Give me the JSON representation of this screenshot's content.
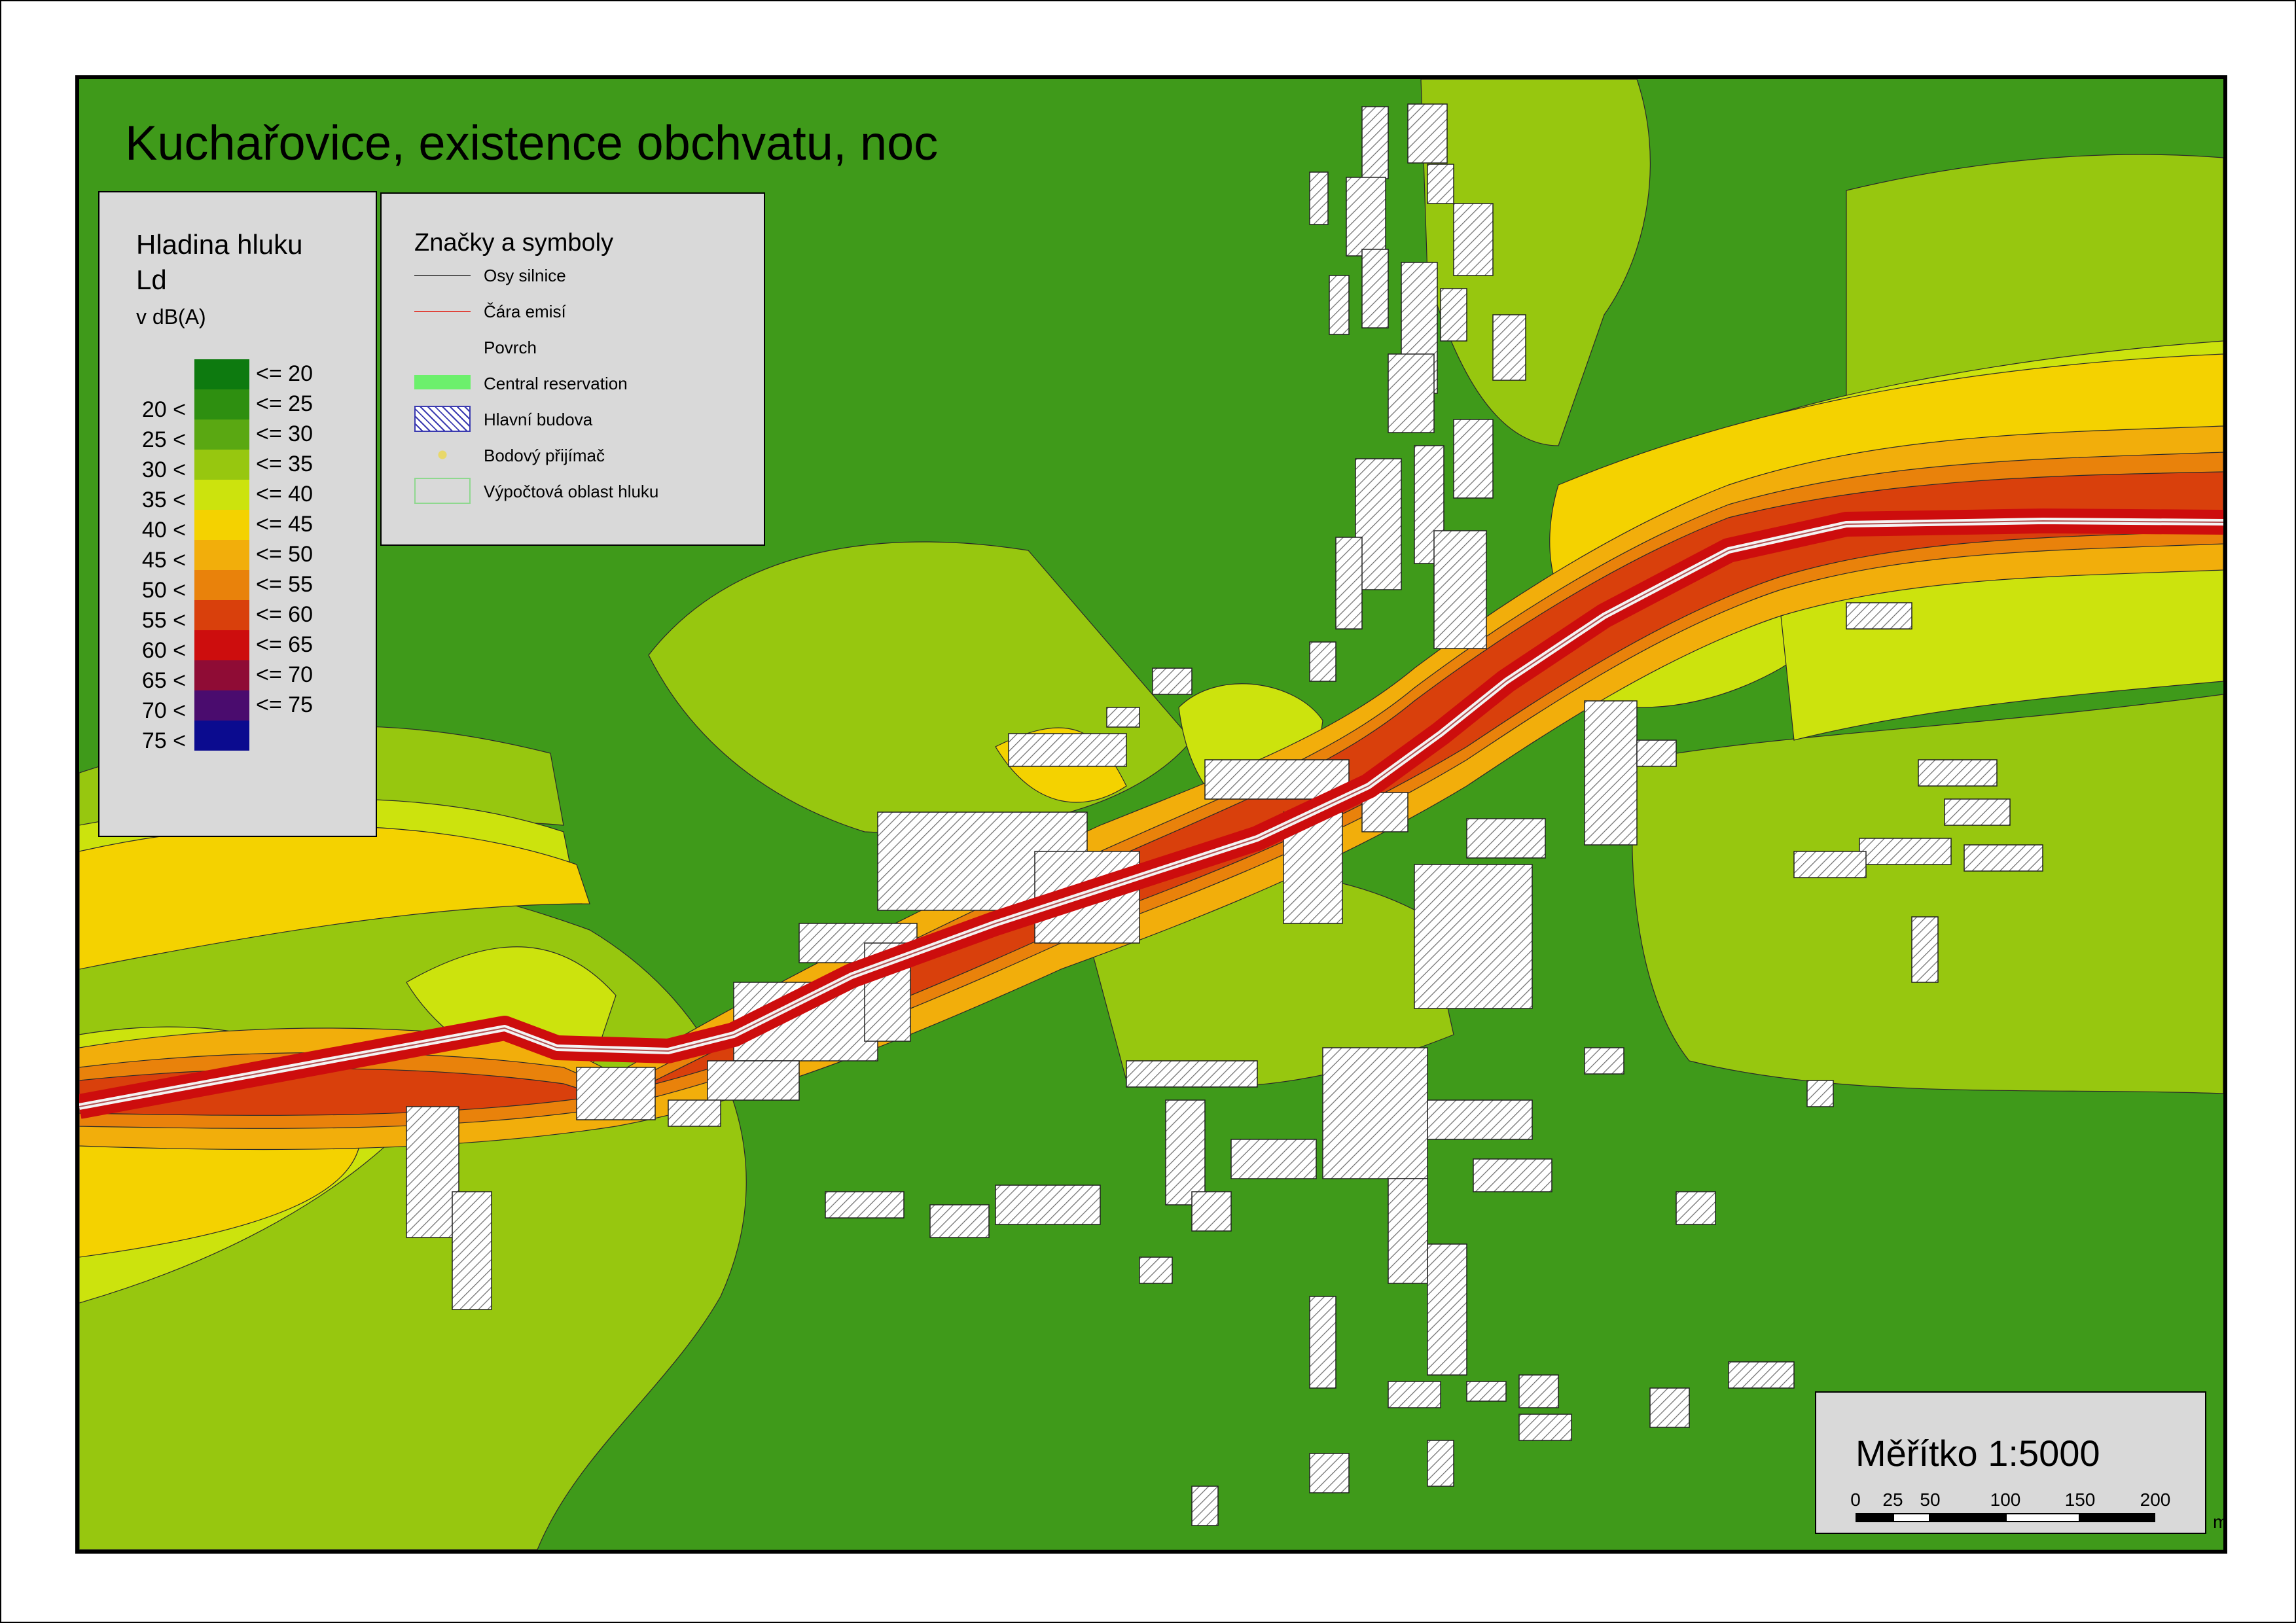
{
  "map_title": "Kuchařovice, existence obchvatu, noc",
  "colors": {
    "road": "#dc3a0c",
    "road_center": "#f3f3f3",
    "building_fill": "#ffffff",
    "building_hatch": "#707070",
    "frame": "#000000",
    "panel_bg": "#d9d9d9"
  },
  "legend": {
    "title_line1": "Hladina hluku",
    "title_line2": "Ld",
    "unit": "v dB(A)",
    "classes": [
      {
        "lower": "",
        "upper": "<= 20",
        "color": "#0d7a0f"
      },
      {
        "lower": "20 <",
        "upper": "<= 25",
        "color": "#2e8f10"
      },
      {
        "lower": "25 <",
        "upper": "<= 30",
        "color": "#5aa812"
      },
      {
        "lower": "30 <",
        "upper": "<= 35",
        "color": "#97c70f"
      },
      {
        "lower": "35 <",
        "upper": "<= 40",
        "color": "#cce30d"
      },
      {
        "lower": "40 <",
        "upper": "<= 45",
        "color": "#f4d200"
      },
      {
        "lower": "45 <",
        "upper": "<= 50",
        "color": "#f2ae0b"
      },
      {
        "lower": "50 <",
        "upper": "<= 55",
        "color": "#e9820b"
      },
      {
        "lower": "55 <",
        "upper": "<= 60",
        "color": "#d9400c"
      },
      {
        "lower": "60 <",
        "upper": "<= 65",
        "color": "#cd0d0d"
      },
      {
        "lower": "65 <",
        "upper": "<= 70",
        "color": "#8f0c35"
      },
      {
        "lower": "70 <",
        "upper": "<= 75",
        "color": "#4a0c6e"
      },
      {
        "lower": "75 <",
        "upper": "",
        "color": "#0b0b8f"
      }
    ]
  },
  "symbols": {
    "title": "Značky a symboly",
    "items": [
      {
        "label": "Osy silnice",
        "kind": "line",
        "color": "#555555"
      },
      {
        "label": "Čára emisí",
        "kind": "line",
        "color": "#e0443c"
      },
      {
        "label": "Povrch",
        "kind": "none",
        "color": ""
      },
      {
        "label": "Central reservation",
        "kind": "band",
        "color": "#6cf06c"
      },
      {
        "label": "Hlavní budova",
        "kind": "hatch",
        "color": "#3a3ab0"
      },
      {
        "label": "Bodový přijímač",
        "kind": "point",
        "color": "#e8d86a"
      },
      {
        "label": "Výpočtová oblast hluku",
        "kind": "box",
        "color": "#8fd88f"
      }
    ]
  },
  "scale": {
    "title": "Měřítko 1:5000",
    "ticks": [
      "0",
      "25",
      "50",
      "100",
      "150",
      "200"
    ],
    "unit": "m"
  }
}
